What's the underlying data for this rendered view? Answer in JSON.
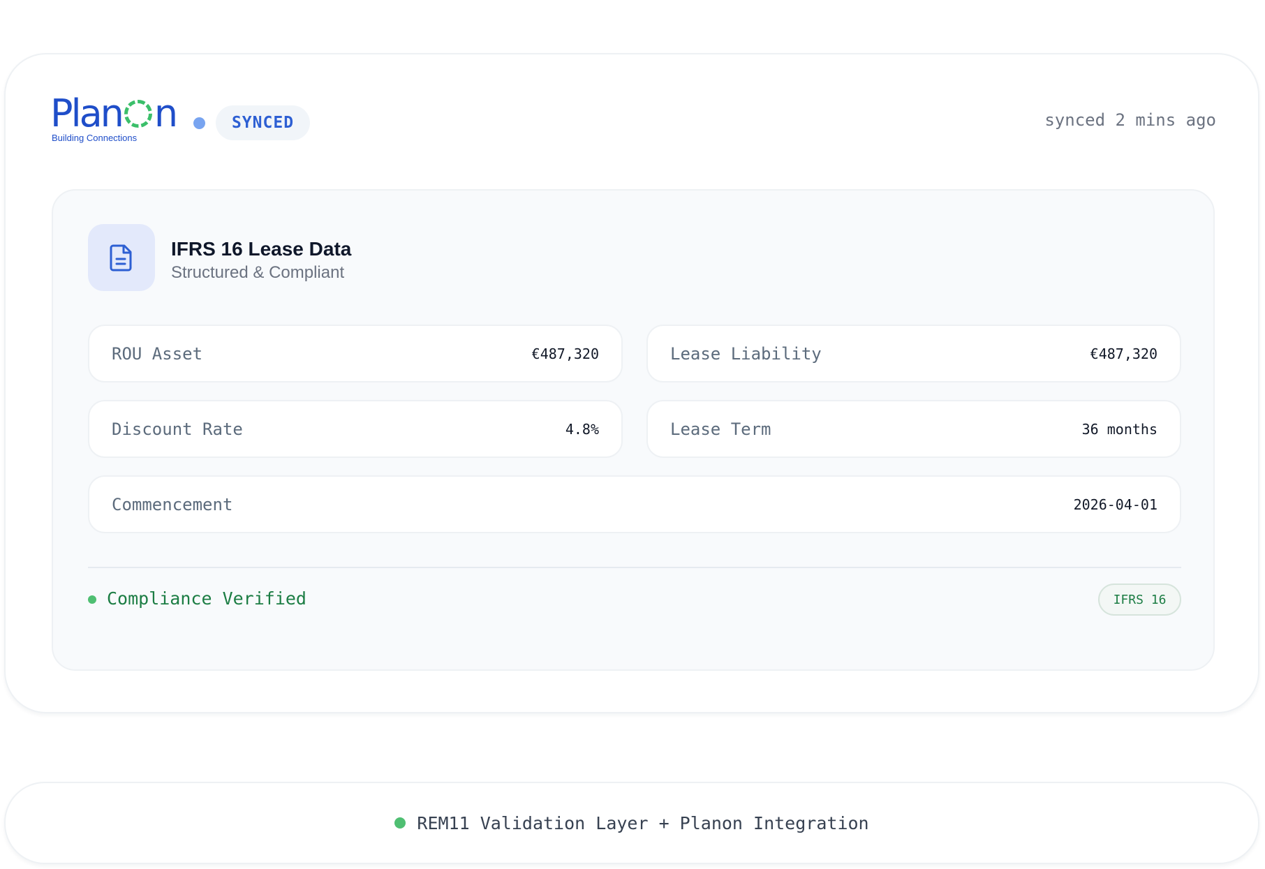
{
  "header": {
    "logo_text_a": "Plan",
    "logo_text_b": "n",
    "logo_tagline": "Building Connections",
    "sync_badge": "SYNCED",
    "sync_time": "synced 2 mins ago"
  },
  "panel": {
    "icon": "document-icon",
    "title": "IFRS 16 Lease Data",
    "subtitle": "Structured & Compliant",
    "fields": [
      {
        "label": "ROU Asset",
        "value": "€487,320"
      },
      {
        "label": "Lease Liability",
        "value": "€487,320"
      },
      {
        "label": "Discount Rate",
        "value": "4.8%"
      },
      {
        "label": "Lease Term",
        "value": "36 months"
      },
      {
        "label": "Commencement",
        "value": "2026-04-01"
      }
    ],
    "compliance_text": "Compliance Verified",
    "compliance_badge": "IFRS 16"
  },
  "footer": {
    "text": "REM11 Validation Layer + Planon Integration"
  },
  "colors": {
    "brand_blue": "#1f4ec9",
    "accent_green": "#4fbf72",
    "compliance_green": "#1c7d44"
  }
}
